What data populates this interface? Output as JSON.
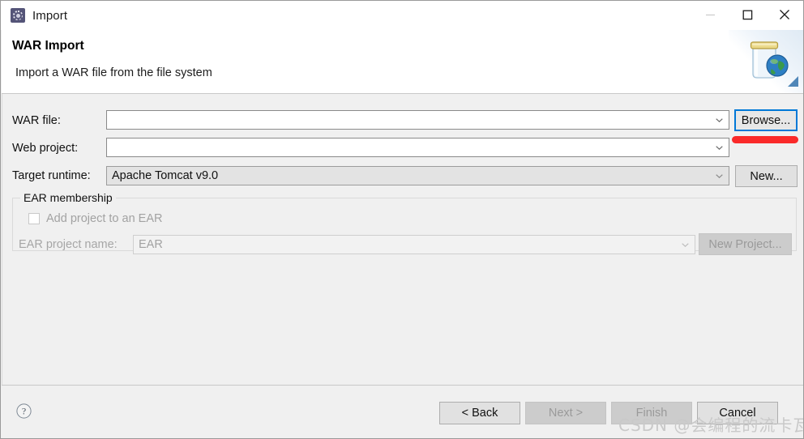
{
  "window": {
    "title": "Import",
    "icon": "eclipse-import-icon",
    "controls": {
      "minimize": "minimize-icon",
      "maximize": "maximize-icon",
      "close": "close-icon"
    }
  },
  "header": {
    "title": "WAR Import",
    "description": "Import a WAR file from the file system",
    "banner_icon": "war-globe-icon"
  },
  "form": {
    "war_file": {
      "label": "WAR file:",
      "value": "",
      "placeholder": "",
      "browse_label": "Browse..."
    },
    "web_project": {
      "label": "Web project:",
      "value": "",
      "placeholder": ""
    },
    "target_runtime": {
      "label": "Target runtime:",
      "value": "Apache Tomcat v9.0",
      "new_label": "New..."
    }
  },
  "ear_membership": {
    "group_title": "EAR membership",
    "add_project_label": "Add project to an EAR",
    "add_project_checked": false,
    "project_name_label": "EAR project name:",
    "project_name_value": "EAR",
    "new_project_label": "New Project..."
  },
  "footer": {
    "help_icon": "help-circle-icon",
    "buttons": [
      {
        "label": "< Back",
        "name": "back-button",
        "disabled": false
      },
      {
        "label": "Next >",
        "name": "next-button",
        "disabled": true
      },
      {
        "label": "Finish",
        "name": "finish-button",
        "disabled": true
      },
      {
        "label": "Cancel",
        "name": "cancel-button",
        "disabled": false
      }
    ]
  },
  "annotation": {
    "red_mark": "red-highlight-stroke"
  },
  "watermark": {
    "text": "CSDN @会编程的流卡瓦"
  },
  "colors": {
    "accent": "#0078d7",
    "annotation_red": "#fa2a2a",
    "window_bg": "#f0f0f0",
    "header_bg": "#ffffff"
  }
}
